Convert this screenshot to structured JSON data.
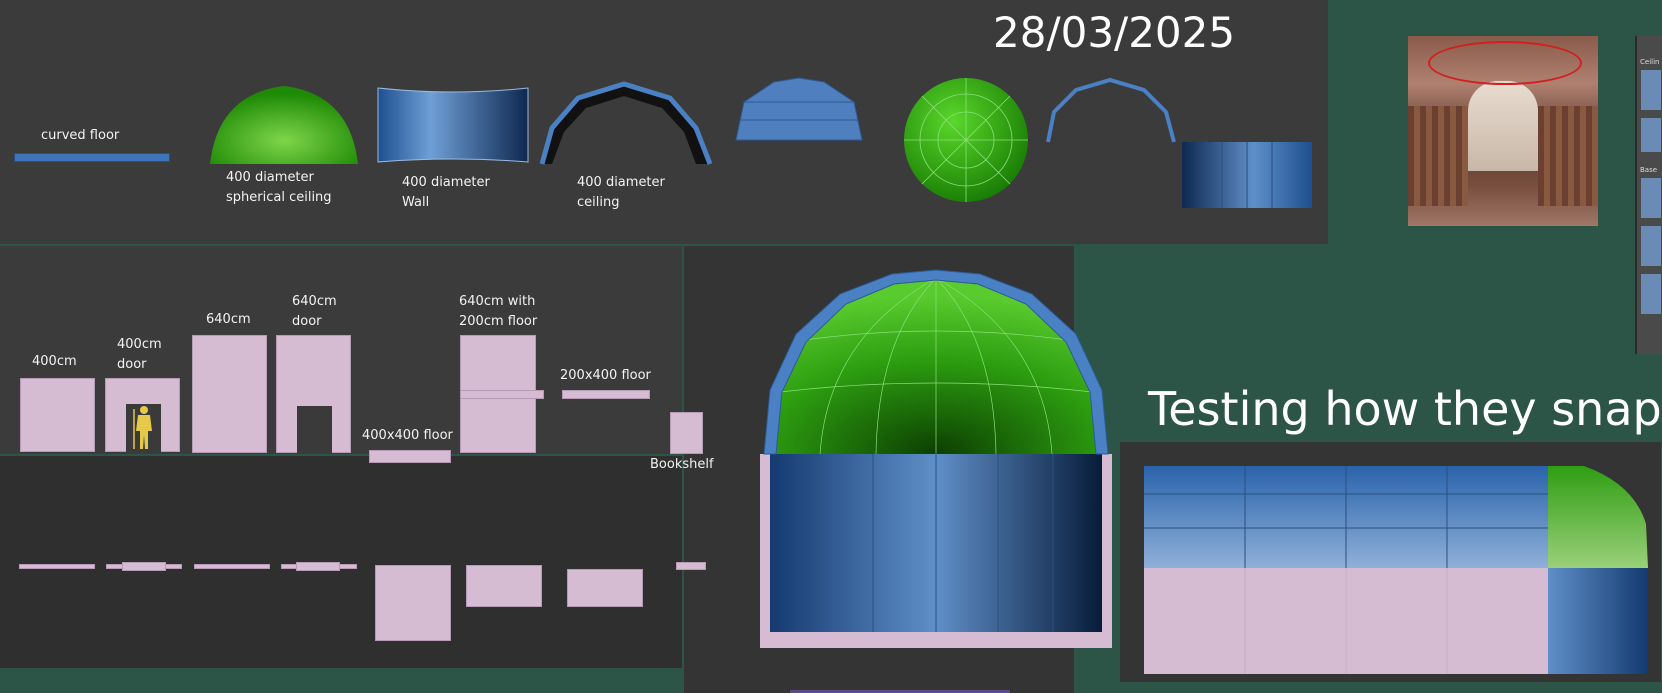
{
  "date": "28/03/2025",
  "snap_title": "Testing how they snap",
  "labels": {
    "curved_floor": "curved floor",
    "spherical_ceiling_1": "400 diameter",
    "spherical_ceiling_2": "spherical ceiling",
    "wall_1": "400 diameter",
    "wall_2": "Wall",
    "ceiling_1": "400 diameter",
    "ceiling_2": "ceiling",
    "w400": "400cm",
    "w400door_1": "400cm",
    "w400door_2": "door",
    "w640": "640cm",
    "w640door_1": "640cm",
    "w640door_2": "door",
    "floor400": "400x400 floor",
    "w640floor_1": "640cm with",
    "w640floor_2": "200cm floor",
    "floor200": "200x400 floor",
    "bookshelf": "Bookshelf"
  },
  "colors": {
    "background": "#2c5547",
    "viewport": "#3b3b3b",
    "blue": "#3f74b8",
    "green": "#2f9e12",
    "pink": "#d6bcd3"
  },
  "reference_image": "library-photo",
  "ui_strip_labels": [
    "Ceilin",
    "Base"
  ]
}
